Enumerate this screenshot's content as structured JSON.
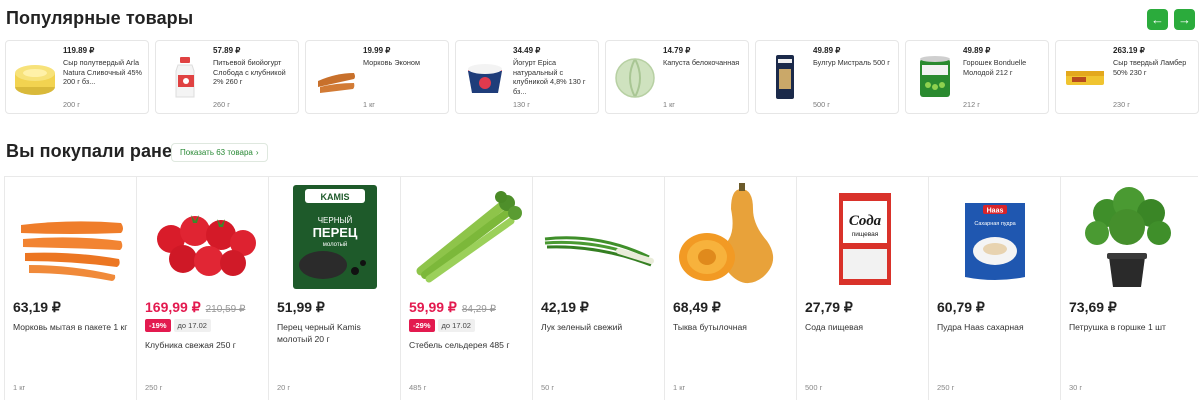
{
  "popular": {
    "title": "Популярные товары",
    "prev_icon": "arrow-left-icon",
    "next_icon": "arrow-right-icon",
    "prev_glyph": "←",
    "next_glyph": "→",
    "items": [
      {
        "price": "119.89 ₽",
        "name": "Сыр полутвердый Arla Natura Сливочный 45% 200 г бз...",
        "weight": "200 г",
        "icon": "cheese-icon"
      },
      {
        "price": "57.89 ₽",
        "name": "Питьевой биойогурт Слобода с клубникой 2% 260 г",
        "weight": "260 г",
        "icon": "yogurt-bottle-icon"
      },
      {
        "price": "19.99 ₽",
        "name": "Морковь Эконом",
        "weight": "1 кг",
        "icon": "carrot-icon"
      },
      {
        "price": "34.49 ₽",
        "name": "Йогурт Epica натуральный с клубникой 4,8% 130 г бз...",
        "weight": "130 г",
        "icon": "yogurt-cup-icon"
      },
      {
        "price": "14.79 ₽",
        "name": "Капуста белокочанная",
        "weight": "1 кг",
        "icon": "cabbage-icon"
      },
      {
        "price": "49.89 ₽",
        "name": "Булгур Мистраль 500 г",
        "weight": "500 г",
        "icon": "bulgur-pack-icon"
      },
      {
        "price": "49.89 ₽",
        "name": "Горошек Bonduelle Молодой 212 г",
        "weight": "212 г",
        "icon": "pea-can-icon"
      },
      {
        "price": "263.19 ₽",
        "name": "Сыр твердый Ламбер 50% 230 г",
        "weight": "230 г",
        "icon": "cheese-bar-icon"
      }
    ]
  },
  "previous": {
    "title": "Вы покупали ранее",
    "show_label": "Показать 63 товара",
    "show_chevron": "›",
    "items": [
      {
        "price": "63,19 ₽",
        "name": "Морковь мытая в пакете 1 кг",
        "weight": "1 кг",
        "icon": "carrots-icon"
      },
      {
        "price": "169,99 ₽",
        "old_price": "210,59 ₽",
        "discount": "-19%",
        "until": "до 17.02",
        "name": "Клубника свежая 250 г",
        "weight": "250 г",
        "icon": "strawberries-icon"
      },
      {
        "price": "51,99 ₽",
        "name": "Перец черный Kamis молотый 20 г",
        "weight": "20 г",
        "icon": "pepper-pack-icon",
        "pack_brand": "KAMIS",
        "pack_l1": "ЧЕРНЫЙ",
        "pack_l2": "ПЕРЕЦ",
        "pack_l3": "молотый"
      },
      {
        "price": "59,99 ₽",
        "old_price": "84,29 ₽",
        "discount": "-29%",
        "until": "до 17.02",
        "name": "Стебель сельдерея 485 г",
        "weight": "485 г",
        "icon": "celery-icon"
      },
      {
        "price": "42,19 ₽",
        "name": "Лук зеленый свежий",
        "weight": "50 г",
        "icon": "green-onion-icon"
      },
      {
        "price": "68,49 ₽",
        "name": "Тыква бутылочная",
        "weight": "1 кг",
        "icon": "butternut-icon"
      },
      {
        "price": "27,79 ₽",
        "name": "Сода пищевая",
        "weight": "500 г",
        "icon": "soda-box-icon",
        "pack_l1": "Сода",
        "pack_l2": "пищевая"
      },
      {
        "price": "60,79 ₽",
        "name": "Пудра Haas сахарная",
        "weight": "250 г",
        "icon": "sugar-powder-icon",
        "pack_brand": "Haas",
        "pack_l1": "Сахарная пудра"
      },
      {
        "price": "73,69 ₽",
        "name": "Петрушка в горшке 1 шт",
        "weight": "30 г",
        "icon": "parsley-pot-icon"
      }
    ]
  },
  "colors": {
    "accent": "#2bab3c",
    "sale": "#e31a4f"
  }
}
